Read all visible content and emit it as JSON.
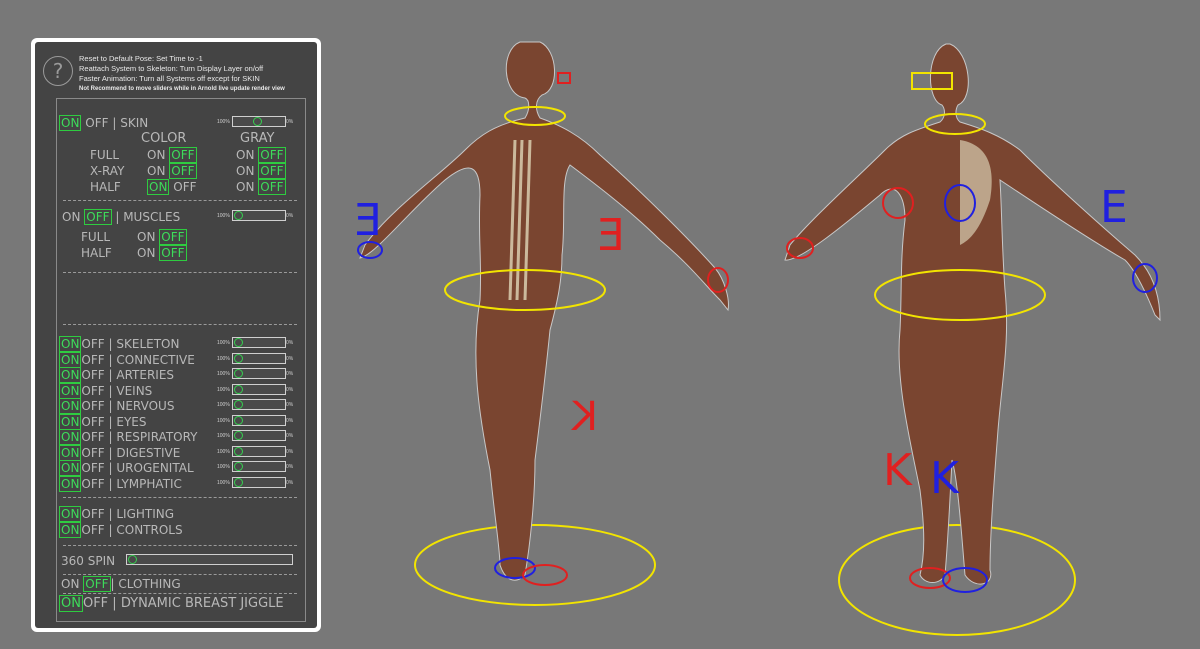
{
  "header": {
    "help_icon": "question-icon",
    "lines": [
      "Reset to Default Pose: Set Time to -1",
      "Reattach System to Skeleton: Turn Display Layer on/off",
      "Faster Animation: Turn all Systems off except for SKIN"
    ],
    "note": "Not Recommend to move sliders while in Arnold live update render view"
  },
  "labels": {
    "on": "ON",
    "off": "OFF",
    "sep": "|",
    "pct100": "100%",
    "pct0": "0%"
  },
  "skin": {
    "label": "SKIN",
    "color_header": "COLOR",
    "gray_header": "GRAY",
    "modes": [
      "FULL",
      "X-RAY",
      "HALF"
    ]
  },
  "muscles": {
    "label": "MUSCLES",
    "modes": [
      "FULL",
      "HALF"
    ]
  },
  "systems": [
    {
      "label": "SKELETON"
    },
    {
      "label": "CONNECTIVE"
    },
    {
      "label": "ARTERIES"
    },
    {
      "label": "VEINS"
    },
    {
      "label": "NERVOUS"
    },
    {
      "label": "EYES"
    },
    {
      "label": "RESPIRATORY"
    },
    {
      "label": "DIGESTIVE"
    },
    {
      "label": "UROGENITAL"
    },
    {
      "label": "LYMPHATIC"
    }
  ],
  "lighting": {
    "label": "LIGHTING"
  },
  "controls": {
    "label": "CONTROLS"
  },
  "spin": {
    "label": "360 SPIN",
    "level": 0
  },
  "clothing": {
    "label": "CLOTHING"
  },
  "jiggle": {
    "label": "DYNAMIC BREAST JIGGLE"
  },
  "viewport": {
    "marker_E": "E",
    "marker_K": "K",
    "colors": {
      "control_yellow": "#f2e400",
      "control_red": "#e02020",
      "control_blue": "#2020e0",
      "skin": "#7a4530"
    }
  }
}
